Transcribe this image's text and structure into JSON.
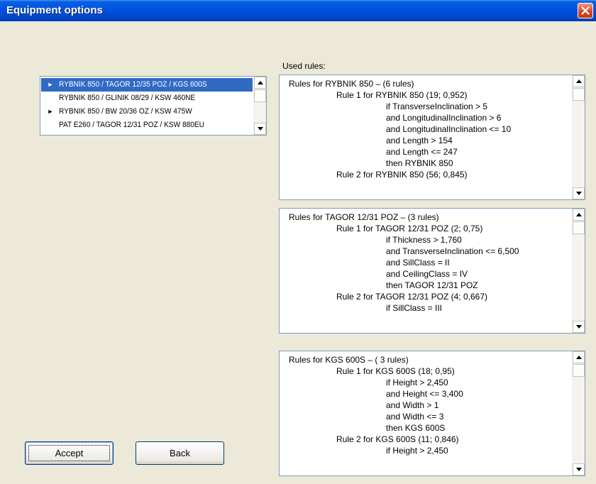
{
  "window": {
    "title": "Equipment options"
  },
  "equipment_list": {
    "items": [
      {
        "label": "RYBNIK 850 / TAGOR 12/35 POZ / KGS 600S",
        "marker": "►",
        "selected": true
      },
      {
        "label": "RYBNIK 850 / GLINIK 08/29 / KSW 460NE",
        "marker": "",
        "selected": false
      },
      {
        "label": "RYBNIK 850 / BW 20/36 OZ / KSW 475W",
        "marker": "►",
        "selected": false
      },
      {
        "label": "PAT E260 / TAGOR 12/31 POZ / KSW 880EU",
        "marker": "",
        "selected": false
      }
    ]
  },
  "used_rules": {
    "label": "Used rules:",
    "boxes": [
      {
        "lines": [
          "Rules for RYBNIK 850 – (6 rules)",
          "Rule 1 for  RYBNIK 850 (19; 0,952)",
          "if TransverseInclination > 5",
          "and LongitudinalInclination > 6",
          "and LongitudinalInclination <= 10",
          "and Length > 154",
          "and Length <= 247",
          "then RYBNIK 850",
          "Rule 2 for  RYBNIK 850 (56; 0,845)"
        ]
      },
      {
        "lines": [
          "Rules  for TAGOR 12/31 POZ – (3 rules)",
          "Rule 1 for  TAGOR 12/31 POZ (2; 0,75)",
          "if Thickness > 1,760",
          "and TransverseInclination <= 6,500",
          "and SillClass = II",
          "and CeilingClass = IV",
          "then TAGOR 12/31 POZ",
          "Rule 2 for  TAGOR 12/31 POZ (4; 0,667)",
          "if SillClass = III"
        ]
      },
      {
        "lines": [
          "Rules  for KGS 600S – ( 3 rules)",
          "Rule 1 for  KGS 600S (18; 0,95)",
          "if Height > 2,450",
          "and Height <= 3,400",
          "and Width > 1",
          "and Width <= 3",
          "then KGS 600S",
          "Rule 2 for  KGS 600S (11; 0,846)",
          "if Height > 2,450"
        ]
      }
    ]
  },
  "buttons": {
    "accept": "Accept",
    "back": "Back"
  },
  "icons": {
    "close": "close-icon",
    "scroll_up": "scroll-up-arrow-icon",
    "scroll_down": "scroll-down-arrow-icon"
  },
  "colors": {
    "title_bar": "#0054e3",
    "selection": "#316ac5",
    "dialog_bg": "#ece9d8",
    "close": "#d64b25"
  }
}
